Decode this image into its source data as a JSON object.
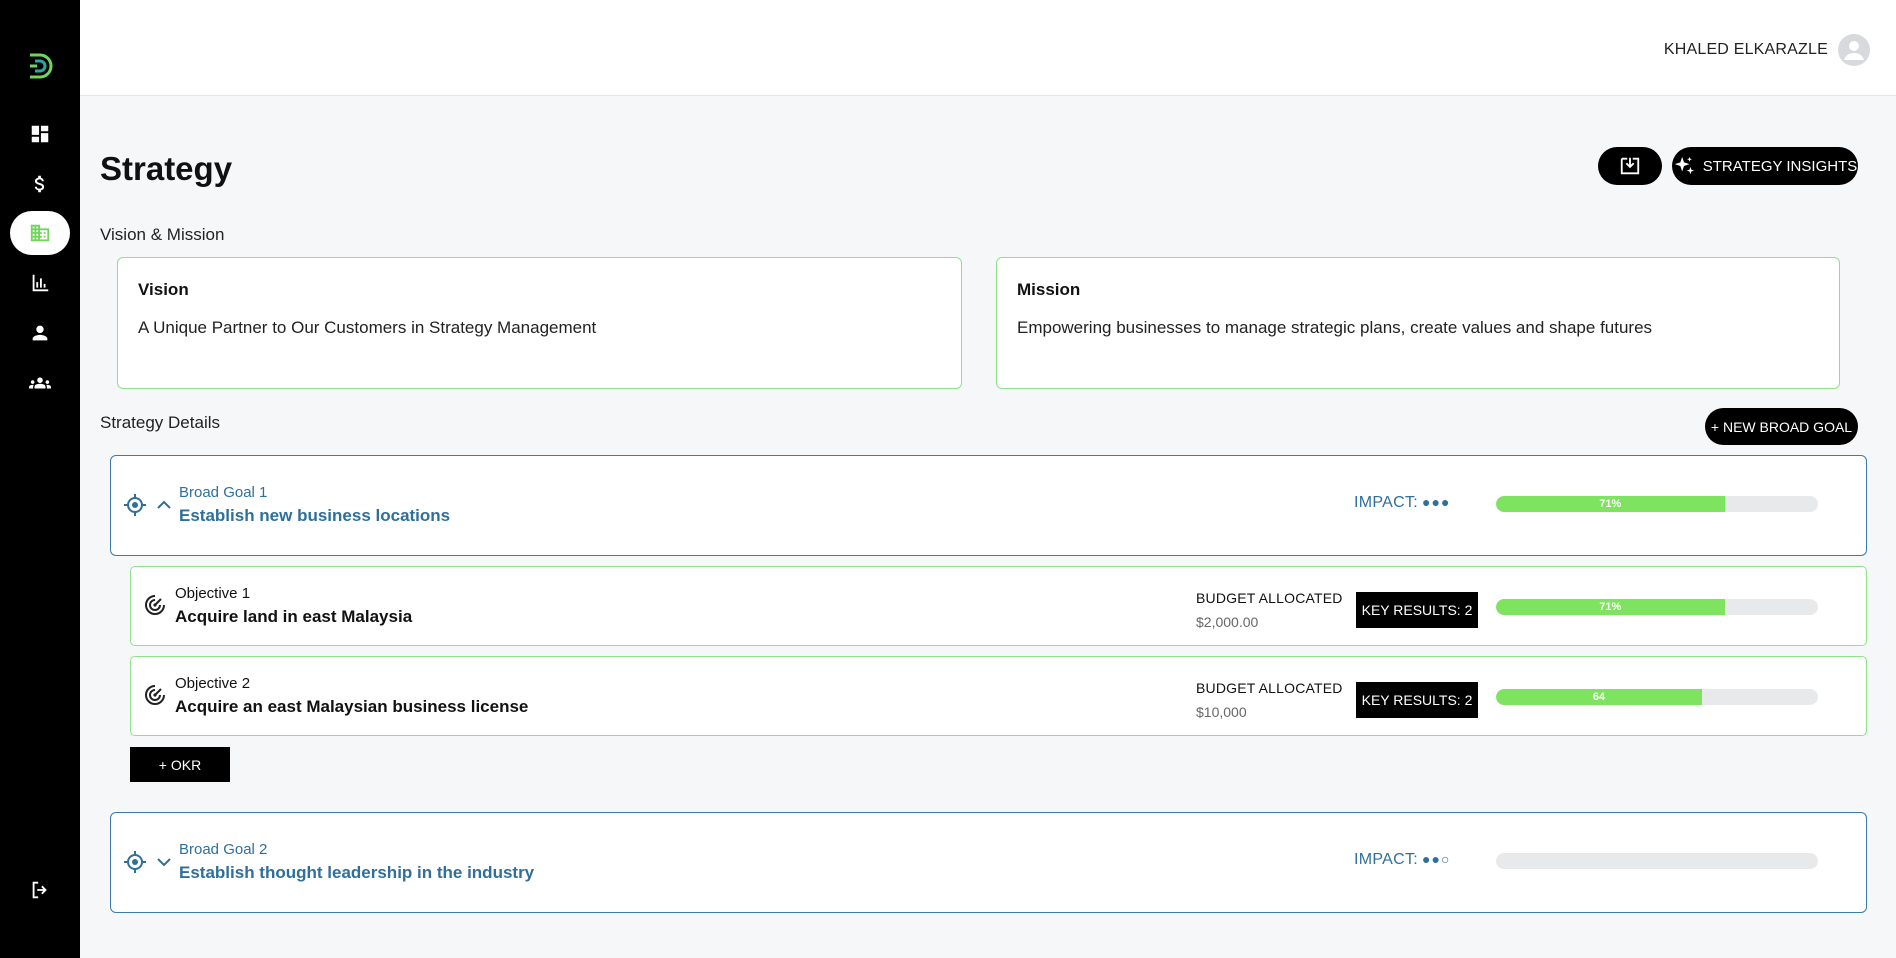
{
  "app": {
    "user_name": "KHALED ELKARAZLE"
  },
  "sidebar": {
    "items": [
      {
        "name": "dashboard",
        "icon": "dashboard-icon"
      },
      {
        "name": "finance",
        "icon": "dollar-icon"
      },
      {
        "name": "strategy",
        "icon": "building-icon",
        "active": true
      },
      {
        "name": "reports",
        "icon": "bar-chart-icon"
      },
      {
        "name": "profile",
        "icon": "person-icon"
      },
      {
        "name": "team",
        "icon": "group-icon"
      }
    ],
    "logout_icon": "logout-icon"
  },
  "colors": {
    "accent_green": "#7ee35f",
    "goal_blue": "#2f6f9c",
    "sidebar_bg": "#000000"
  },
  "page": {
    "title": "Strategy",
    "insights_label": "STRATEGY INSIGHTS",
    "vision_mission_label": "Vision & Mission",
    "vision": {
      "title": "Vision",
      "text": "A Unique Partner to Our Customers in Strategy Management"
    },
    "mission": {
      "title": "Mission",
      "text": "Empowering businesses to manage strategic plans, create values and shape futures"
    },
    "details_label": "Strategy Details",
    "new_goal_label": "+ NEW BROAD GOAL",
    "okr_label": "+ OKR"
  },
  "goals": [
    {
      "subtitle": "Broad Goal 1",
      "title": "Establish new business locations",
      "impact_label": "IMPACT:",
      "impact_dots": "●●●",
      "progress_text": "71%",
      "progress": 0.71,
      "expanded": true,
      "objectives": [
        {
          "subtitle": "Objective 1",
          "title": "Acquire land in east Malaysia",
          "budget_label": "BUDGET ALLOCATED",
          "budget_value": "$2,000.00",
          "key_results": "KEY RESULTS: 2",
          "progress_text": "71%",
          "progress": 0.71
        },
        {
          "subtitle": "Objective 2",
          "title": "Acquire an east Malaysian business license",
          "budget_label": "BUDGET ALLOCATED",
          "budget_value": "$10,000",
          "key_results": "KEY RESULTS: 2",
          "progress_text": "64",
          "progress": 0.64
        }
      ]
    },
    {
      "subtitle": "Broad Goal 2",
      "title": "Establish thought leadership in the industry",
      "impact_label": "IMPACT:",
      "impact_dots": "●●○",
      "progress_text": "",
      "progress": 0,
      "expanded": false
    }
  ]
}
